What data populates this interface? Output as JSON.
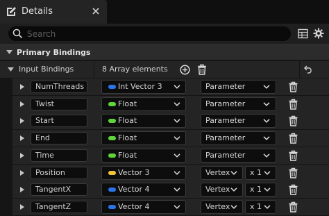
{
  "window": {
    "tab_title": "Details"
  },
  "search": {
    "placeholder": "Search"
  },
  "category": {
    "title": "Primary Bindings"
  },
  "property": {
    "label": "Input Bindings",
    "count_text": "8 Array elements"
  },
  "rows": [
    {
      "name": "NumThreads",
      "type": "Int Vector 3",
      "type_color": "#2a73e8",
      "binding": "Parameter"
    },
    {
      "name": "Twist",
      "type": "Float",
      "type_color": "#5ed43a",
      "binding": "Parameter"
    },
    {
      "name": "Start",
      "type": "Float",
      "type_color": "#5ed43a",
      "binding": "Parameter"
    },
    {
      "name": "End",
      "type": "Float",
      "type_color": "#5ed43a",
      "binding": "Parameter"
    },
    {
      "name": "Time",
      "type": "Float",
      "type_color": "#5ed43a",
      "binding": "Parameter"
    },
    {
      "name": "Position",
      "type": "Vector 3",
      "type_color": "#f2c23a",
      "binding": "Vertex",
      "count": "x 1"
    },
    {
      "name": "TangentX",
      "type": "Vector 4",
      "type_color": "#2a73e8",
      "binding": "Vertex",
      "count": "x 1"
    },
    {
      "name": "TangentZ",
      "type": "Vector 4",
      "type_color": "#2a73e8",
      "binding": "Vertex",
      "count": "x 1"
    }
  ],
  "icons": {
    "tab": "pencil-document-icon",
    "close": "close-icon",
    "search": "search-icon",
    "table": "table-view-icon",
    "settings": "gear-icon",
    "add": "add-element-icon",
    "delete": "trash-icon",
    "reset": "reset-arrow-icon"
  }
}
